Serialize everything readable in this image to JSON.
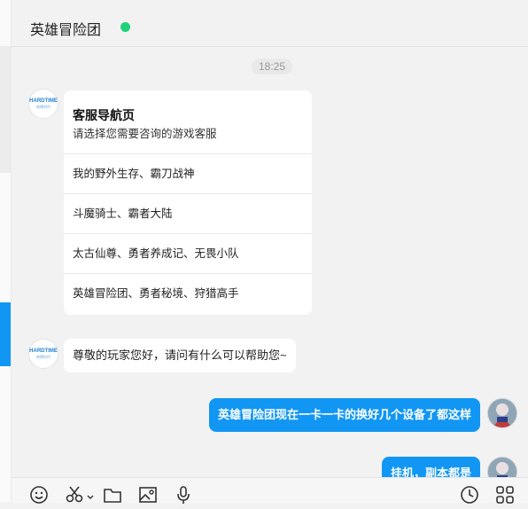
{
  "header": {
    "title": "英雄冒险团",
    "status_color": "#21d17a"
  },
  "timestamp": "18:25",
  "brand_avatar": {
    "word": "HARDTIME",
    "sub": "哈德时代"
  },
  "nav_card": {
    "title": "客服导航页",
    "subtitle": "请选择您需要咨询的游戏客服",
    "options": [
      "我的野外生存、霸刀战神",
      "斗魔骑士、霸者大陆",
      "太古仙尊、勇者养成记、无畏小队",
      "英雄冒险团、勇者秘境、狩猎高手"
    ]
  },
  "messages": {
    "greeting": "尊敬的玩家您好，请问有什么可以帮助您~",
    "user_1": "英雄冒险团现在一卡一卡的换好几个设备了都这样",
    "user_2": "挂机，副本都是"
  },
  "toolbar": {
    "icons": [
      "emoji-icon",
      "scissors-icon",
      "chevron-down-icon",
      "folder-icon",
      "image-icon",
      "microphone-icon",
      "clock-icon",
      "apps-icon"
    ]
  },
  "colors": {
    "accent": "#1296f3",
    "online": "#21d17a",
    "background": "#f2f2f2"
  }
}
